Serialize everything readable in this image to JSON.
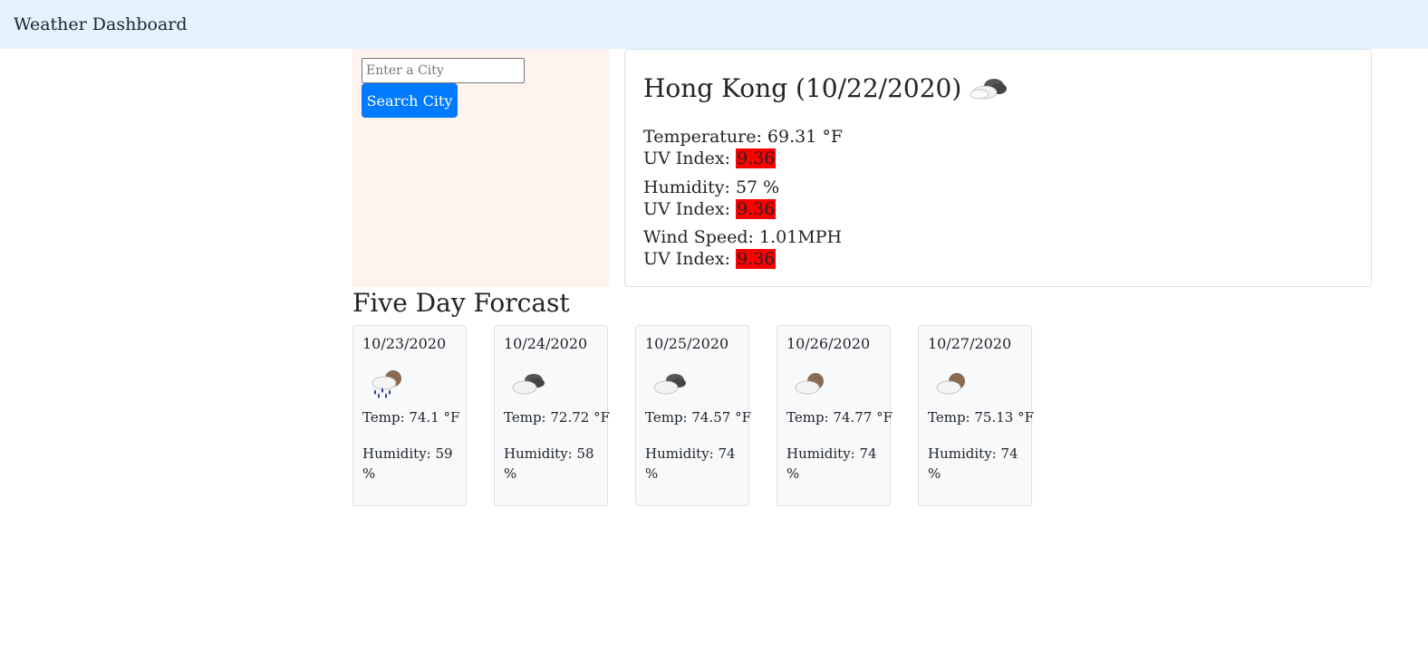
{
  "navbar": {
    "title": "Weather Dashboard"
  },
  "search": {
    "placeholder": "Enter a City",
    "value": "",
    "button_label": "Search City"
  },
  "current": {
    "heading": "Hong Kong (10/22/2020)",
    "icon": "cloudy-icon",
    "temperature_label": "Temperature: 69.31 °F",
    "humidity_label": "Humidity: 57 %",
    "wind_label": "Wind Speed: 1.01MPH",
    "uv_label": "UV Index: ",
    "uv_value": "9.36",
    "uv_color": "#ff0000"
  },
  "forecast": {
    "title": "Five Day Forcast",
    "days": [
      {
        "date": "10/23/2020",
        "icon": "rain-icon",
        "temp": "Temp: 74.1 °F",
        "humidity": "Humidity: 59 %"
      },
      {
        "date": "10/24/2020",
        "icon": "cloudy-icon",
        "temp": "Temp: 72.72 °F",
        "humidity": "Humidity: 58 %"
      },
      {
        "date": "10/25/2020",
        "icon": "cloudy-icon",
        "temp": "Temp: 74.57 °F",
        "humidity": "Humidity: 74 %"
      },
      {
        "date": "10/26/2020",
        "icon": "partly-cloudy-icon",
        "temp": "Temp: 74.77 °F",
        "humidity": "Humidity: 74 %"
      },
      {
        "date": "10/27/2020",
        "icon": "partly-cloudy-icon",
        "temp": "Temp: 75.13 °F",
        "humidity": "Humidity: 74 %"
      }
    ]
  },
  "colors": {
    "navbar_bg": "#e3f2fd",
    "sidebar_bg": "#fff3ee",
    "button_bg": "#007bff",
    "card_bg": "#f8f9fa"
  }
}
